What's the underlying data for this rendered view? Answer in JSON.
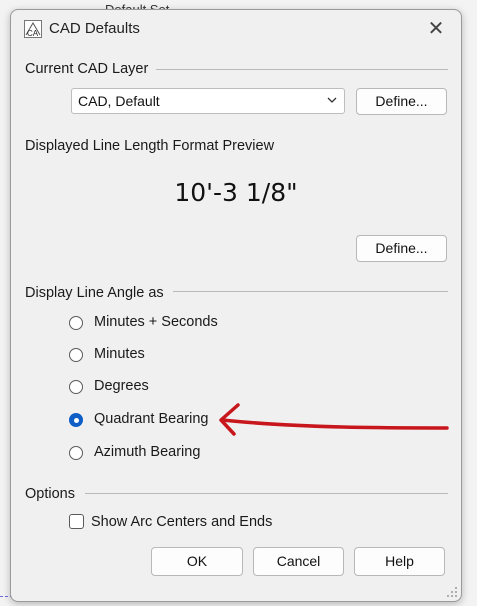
{
  "background": {
    "text": "Default Set"
  },
  "dialog": {
    "title": "CAD Defaults",
    "icon_name": "chief-architect-app-icon",
    "close_glyph": "✕"
  },
  "current_layer": {
    "heading": "Current CAD Layer",
    "select_value": "CAD,  Default",
    "define_label": "Define..."
  },
  "line_length": {
    "heading": "Displayed Line Length Format Preview",
    "preview": "10'-3 1/8\"",
    "define_label": "Define..."
  },
  "angle": {
    "heading": "Display Line Angle as",
    "options": [
      {
        "label": "Minutes + Seconds",
        "checked": false
      },
      {
        "label": "Minutes",
        "checked": false
      },
      {
        "label": "Degrees",
        "checked": false
      },
      {
        "label": "Quadrant Bearing",
        "checked": true
      },
      {
        "label": "Azimuth Bearing",
        "checked": false
      }
    ]
  },
  "options": {
    "heading": "Options",
    "show_arc_centers_label": "Show Arc Centers and Ends",
    "show_arc_centers_checked": false
  },
  "footer": {
    "ok_label": "OK",
    "cancel_label": "Cancel",
    "help_label": "Help"
  },
  "colors": {
    "accent": "#0f5ec7",
    "annotation_arrow": "#c8161d",
    "dialog_bg": "#f0f0f0"
  }
}
